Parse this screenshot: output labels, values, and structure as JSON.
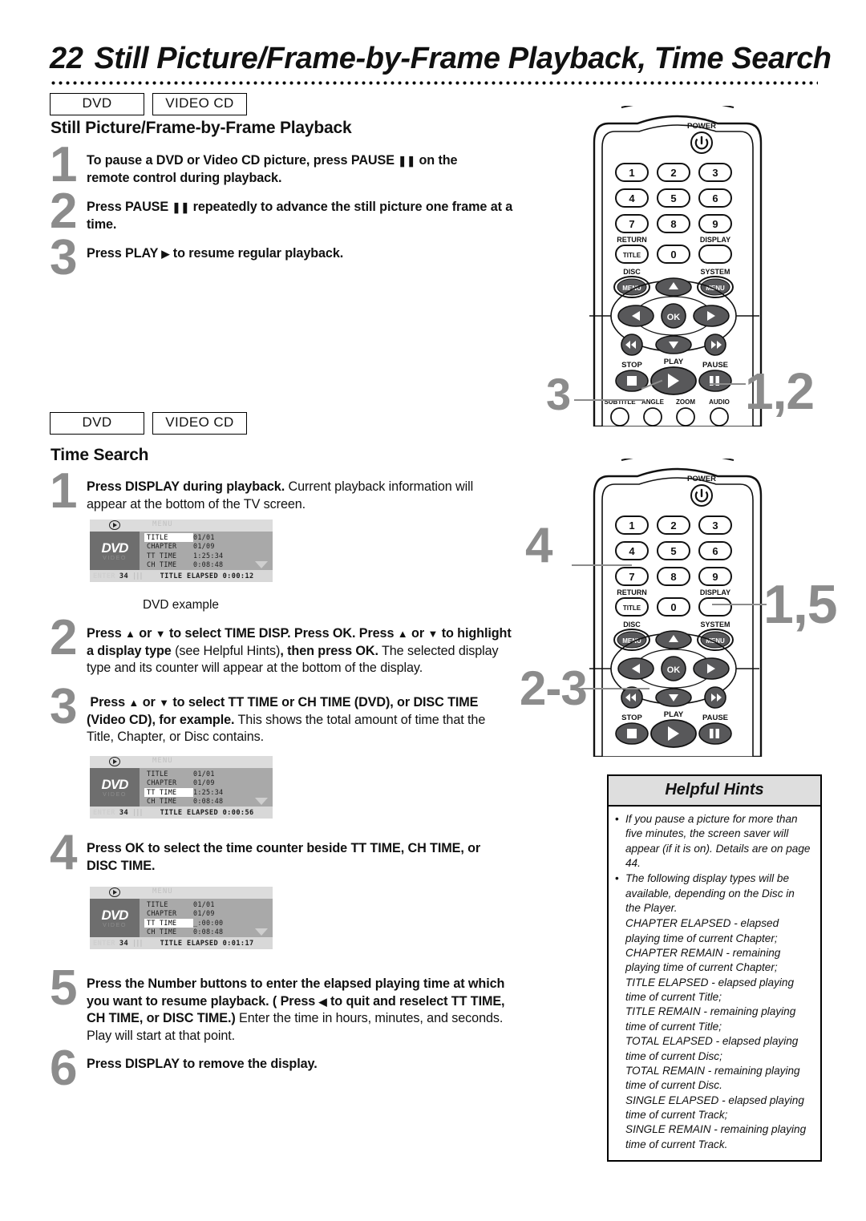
{
  "header": {
    "page_number": "22",
    "title": "Still Picture/Frame-by-Frame Playback, Time Search"
  },
  "sections": [
    {
      "badges": [
        "DVD",
        "VIDEO CD"
      ],
      "heading": "Still Picture/Frame-by-Frame Playback",
      "steps": [
        {
          "num": "1",
          "html": "<b>To pause a DVD or Video CD picture, press PAUSE <span class='glyph'>❚❚</span> on the remote control during playback.</b>"
        },
        {
          "num": "2",
          "html": "<b>Press PAUSE <span class='glyph'>❚❚</span> repeatedly to advance the still picture one frame at a time.</b>"
        },
        {
          "num": "3",
          "html": "<b>Press PLAY <span class='glyph'>▶</span> to resume regular playback.</b>"
        }
      ]
    },
    {
      "badges": [
        "DVD",
        "VIDEO CD"
      ],
      "heading": "Time Search",
      "steps": [
        {
          "num": "1",
          "html": "<b>Press DISPLAY during playback.</b> Current playback information will appear at the bottom of the TV screen."
        },
        {
          "num": "2",
          "html": "<b>Press <span class='glyph'>▲</span> or <span class='glyph'>▼</span> to select TIME DISP. Press OK. Press <span class='glyph'>▲</span> or <span class='glyph'>▼</span> to highlight a display type</b> (see Helpful Hints)<b>, then press OK.</b> The selected display type and its counter will appear at the bottom of the display."
        },
        {
          "num": "3",
          "html": "&nbsp;<b>Press <span class='glyph'>▲</span> or <span class='glyph'>▼</span> to select TT TIME or CH TIME (DVD), or DISC TIME (Video CD), for example.</b> This shows the total amount of time that the Title, Chapter, or Disc contains."
        },
        {
          "num": "4",
          "html": "<b>Press OK to select the time counter beside TT TIME, CH TIME, or DISC TIME.</b>"
        },
        {
          "num": "5",
          "html": "<b>Press the Number buttons to enter the elapsed playing time at which you want to resume playback. ( Press <span class='glyph'>◀</span> to quit and reselect TT TIME, CH TIME, or DISC TIME.)</b> Enter the time in hours, minutes, and seconds. Play will start at that point."
        },
        {
          "num": "6",
          "html": "<b>Press DISPLAY to remove the display.</b>"
        }
      ]
    }
  ],
  "osd_examples": [
    {
      "id": "osd-1",
      "menu_word": "MENU",
      "logo_main": "DVD",
      "logo_sub": "VIDEO",
      "rows": [
        {
          "label": "TITLE",
          "value": "01/01",
          "highlight": "label"
        },
        {
          "label": "CHAPTER",
          "value": "01/09",
          "highlight": "none"
        },
        {
          "label": "TT TIME",
          "value": "1:25:34",
          "highlight": "none"
        },
        {
          "label": "CH TIME",
          "value": "0:08:48",
          "highlight": "none"
        }
      ],
      "bottom_left_faint": "ENTER",
      "bottom_track": "34",
      "bottom_status": "TITLE ELAPSED 0:00:12",
      "caption": "DVD example"
    },
    {
      "id": "osd-2",
      "menu_word": "MENU",
      "logo_main": "DVD",
      "logo_sub": "VIDEO",
      "rows": [
        {
          "label": "TITLE",
          "value": "01/01",
          "highlight": "none"
        },
        {
          "label": "CHAPTER",
          "value": "01/09",
          "highlight": "none"
        },
        {
          "label": "TT TIME",
          "value": "1:25:34",
          "highlight": "label"
        },
        {
          "label": "CH TIME",
          "value": "0:08:48",
          "highlight": "none"
        }
      ],
      "bottom_left_faint": "ENTER",
      "bottom_track": "34",
      "bottom_status": "TITLE ELAPSED 0:00:56",
      "caption": ""
    },
    {
      "id": "osd-3",
      "menu_word": "MENU",
      "logo_main": "DVD",
      "logo_sub": "VIDEO",
      "rows": [
        {
          "label": "TITLE",
          "value": "01/01",
          "highlight": "none"
        },
        {
          "label": "CHAPTER",
          "value": "01/09",
          "highlight": "none"
        },
        {
          "label": "TT TIME",
          "value": "_:00:00",
          "highlight": "label"
        },
        {
          "label": "CH TIME",
          "value": "0:08:48",
          "highlight": "none"
        }
      ],
      "bottom_left_faint": "ENTER",
      "bottom_track": "34",
      "bottom_status": "TITLE ELAPSED 0:01:17",
      "caption": ""
    }
  ],
  "remote": {
    "power_label": "POWER",
    "number_keys": [
      "1",
      "2",
      "3",
      "4",
      "5",
      "6",
      "7",
      "8",
      "9",
      "0"
    ],
    "return_label": "RETURN",
    "title_key": "TITLE",
    "display_label": "DISPLAY",
    "disc_label": "DISC",
    "system_label": "SYSTEM",
    "menu_key": "MENU",
    "ok_key": "OK",
    "stop_label": "STOP",
    "play_label": "PLAY",
    "pause_label": "PAUSE",
    "function_labels": [
      "SUBTITLE",
      "ANGLE",
      "ZOOM",
      "AUDIO"
    ]
  },
  "callouts": {
    "remote1_left": "3",
    "remote1_right": "1,2",
    "remote2_left_top": "4",
    "remote2_right": "1,5",
    "remote2_left_bottom": "2-3"
  },
  "hints": {
    "title": "Helpful Hints",
    "bullet": "•",
    "items": [
      "If you pause a picture for more than five minutes, the screen saver will appear (if it is on). Details are on page 44.",
      "The following display types will be available, depending on the Disc in the Player."
    ],
    "display_types": [
      "CHAPTER ELAPSED - elapsed playing time of current Chapter;",
      "CHAPTER REMAIN - remaining playing time of current Chapter;",
      "TITLE ELAPSED - elapsed playing time of current Title;",
      "TITLE REMAIN - remaining playing time of current Title;",
      "TOTAL ELAPSED - elapsed playing time of current Disc;",
      "TOTAL REMAIN - remaining playing time of current Disc.",
      "SINGLE ELAPSED - elapsed playing time of current Track;",
      "SINGLE REMAIN - remaining playing time of current Track."
    ]
  },
  "colors": {
    "step_number_gray": "#8c8c8c",
    "hint_header_gray": "#dedede",
    "osd_body_gray": "#a9a9a9"
  }
}
